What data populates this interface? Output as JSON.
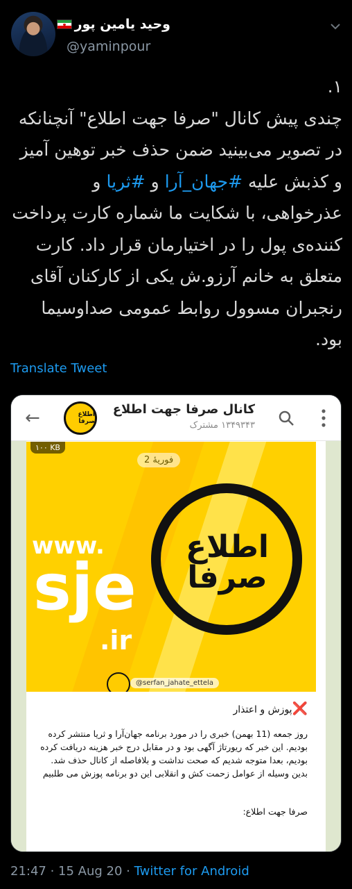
{
  "author": {
    "display_name": "وحید یامین پور",
    "handle": "@yaminpour"
  },
  "tweet": {
    "text_num": "۱.",
    "text_p1": "چندی پیش کانال \"صرفا جهت اطلاع\" آنچنانکه در تصویر می‌بینید ضمن حذف خبر توهین آمیز و کذبش علیه ",
    "tag1": "#جهان_آرا",
    "text_p2": " و ",
    "tag2": "#ثریا",
    "text_p3": " و عذرخواهی، با شکایت ما شماره کارت پرداخت کننده‌ی پول را در اختیارمان قرار داد. کارت متعلق به خانم آرزو.ش یکی از کارکنان آقای رنجبران مسوول روابط عمومی صداوسیما بود.",
    "translate_label": "Translate Tweet"
  },
  "media": {
    "channel_title": "کانال صرفا جهت اطلاع",
    "subscribers": "۱۳۴۹۳۴۳ مشترک",
    "kb_badge": "۱۰۰ KB",
    "date_pill": "فوریهٔ 2",
    "logo_text": "اطلاع صرفا",
    "big_logo_text": "اطلاع صرفا",
    "www": "www.",
    "sje": "sje",
    "ir": ".ir",
    "ig_handle": "@serfan_jahate_ettela",
    "post_heading": "پوزش و اعتذار",
    "post_heading_icon": "❌",
    "post_body": "روز جمعه (11 بهمن) خبری را در مورد برنامه جهان‌آرا و ثریا منتشر کرده بودیم. این خبر که ریورتاژ آگهی بود و در مقابل درج خبر هزینه دریافت کرده بودیم، بعدا متوجه شدیم که صحت نداشت و بلافاصله از کانال حذف شد. بدین وسیله از عوامل زحمت کش و انقلابی این دو برنامه پوزش می طلبیم",
    "post_signature": "صرفا جهت اطلاع:"
  },
  "meta": {
    "time": "21:47",
    "sep": " · ",
    "date": "15 Aug 20",
    "source": "Twitter for Android"
  },
  "colors": {
    "background": "#000000",
    "link": "#1d9bf0",
    "muted": "#8b98a5",
    "brand_yellow": "#ffd000"
  }
}
